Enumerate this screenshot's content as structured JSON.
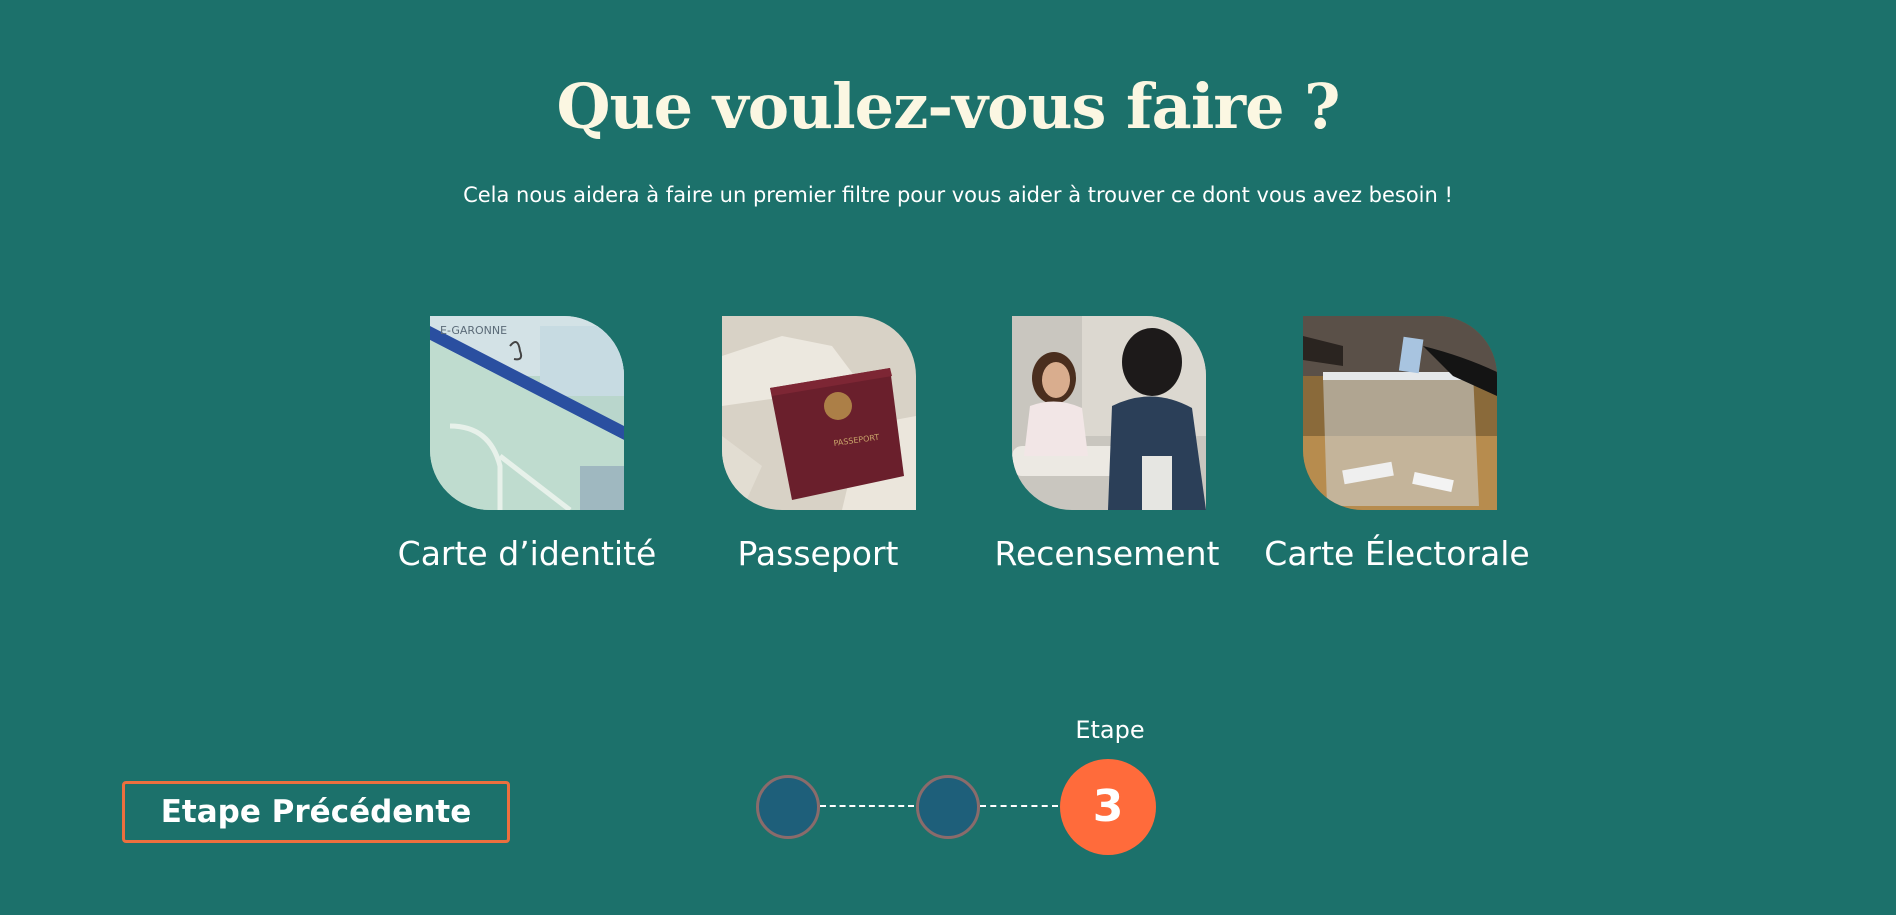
{
  "header": {
    "title": "Que voulez-vous faire ?",
    "subtitle": "Cela nous aidera à faire un premier filtre pour vous aider à trouver ce dont vous avez besoin !"
  },
  "options": [
    {
      "label": "Carte d’identité",
      "image": "id-card-photo"
    },
    {
      "label": "Passeport",
      "image": "passport-photo"
    },
    {
      "label": "Recensement",
      "image": "census-interview-photo"
    },
    {
      "label": "Carte Électorale",
      "image": "ballot-box-photo"
    }
  ],
  "navigation": {
    "previous_label": "Etape Précédente"
  },
  "stepper": {
    "caption": "Etape",
    "current_step": "3",
    "total_steps_shown": 3
  },
  "colors": {
    "background": "#1c716b",
    "accent": "#ff6b3b",
    "title": "#fbf7e2",
    "inactive_step": "#1e5f7a"
  }
}
